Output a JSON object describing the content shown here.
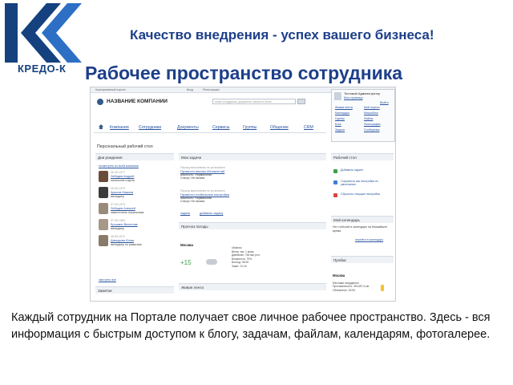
{
  "brand": {
    "logo_text": "КРЕДО-К",
    "colors": {
      "primary": "#15417f",
      "accent": "#2d6fc4"
    }
  },
  "slogan": "Качество внедрения - успех вашего бизнеса!",
  "page_title": "Рабочее пространство сотрудника",
  "caption": "Каждый сотрудник на Портале получает свое личное рабочее пространство. Здесь - вся информация с быстрым доступом к блогу, задачам, файлам, календарям, фотогалерее.",
  "portal": {
    "topbar": {
      "left": "Корпоративный портал",
      "middle": "Вход",
      "right": "Регистрация"
    },
    "company_name": "НАЗВАНИЕ КОМПАНИИ",
    "search_placeholder": "поиск сотрудника, документа, записи в блоге",
    "user": {
      "name": "Тестовый Администратор",
      "links": [
        "Живая лента",
        "Мой портал",
        "Выйти",
        "Календарь",
        "Микроблог",
        "Группы",
        "Файлы",
        "Блог",
        "Фотографии",
        "Задачи",
        "Сообщения"
      ],
      "my_page": "Моя страница"
    },
    "nav": [
      "Компания",
      "Сотрудники",
      "Документы",
      "Сервисы",
      "Группы",
      "Общение",
      "CRM"
    ],
    "section_title": "Персональный рабочий стол",
    "birthdays": {
      "title": "Дни рождения",
      "link": "посмотреть по всей компании",
      "people": [
        {
          "date": "06.05.1977",
          "name": "Лебедев Андрей",
          "role": "начальник отдела"
        },
        {
          "date": "06.05.1979",
          "name": "Крылов Максим",
          "role": "менеджер"
        },
        {
          "date": "07.05.1979",
          "name": "Лебедев Алексей",
          "role": "заместитель начальника"
        },
        {
          "date": "07.05.1983",
          "name": "Брошкин Вячеслав",
          "role": "менеджер"
        },
        {
          "date": "08.05.1972",
          "name": "Давыдова Юлия",
          "role": "менеджер по развитию"
        }
      ],
      "more": "смотреть все"
    },
    "notes_title": "Заметки",
    "tasks": {
      "title": "Мои задачи",
      "items": [
        {
          "meta": "Период выполнения не установлен",
          "title": "Провести анализ обновлений",
          "importance": "Важность: Нормальная",
          "status": "Статус: Не начата"
        },
        {
          "meta": "Период выполнения не установлен",
          "title": "Провести глобальные настройки",
          "importance": "Важность: Нормальная",
          "status": "Статус: Не начата"
        }
      ],
      "links": [
        "задачи",
        "добавить задачу"
      ]
    },
    "weather": {
      "title": "Прогноз погоды",
      "city": "Москва",
      "temp": "+15",
      "details": [
        "облачно",
        "Ветер: юв, 1 м/сек",
        "Давление: 748 мм рт.ст",
        "Влажность: 79%",
        "Восход: 05:06",
        "Закат: 21:16"
      ]
    },
    "feed_title": "Живая лента",
    "desk": {
      "title": "Рабочий стол",
      "buttons": [
        {
          "label": "Добавить гаджет",
          "color": "#3aa04a"
        },
        {
          "label": "Сохранить как настройки по умолчанию",
          "color": "#3a7fd4"
        },
        {
          "label": "Сбросить текущие настройки",
          "color": "#d64545"
        }
      ]
    },
    "calendar": {
      "title": "Мой календарь",
      "text": "Нет событий в календаре на ближайшее время",
      "link": "перейти в календарь"
    },
    "traffic": {
      "title": "Пробки",
      "city": "Москва",
      "lines": [
        "Местами затруднено",
        "Протяженность: 391497,4 км",
        "Обновлено: 20:09"
      ]
    }
  }
}
